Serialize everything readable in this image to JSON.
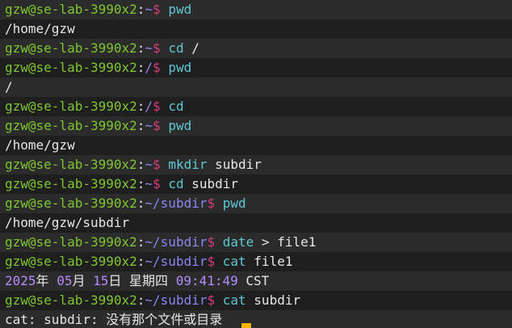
{
  "prompt": {
    "user_host": "gzw@se-lab-3990x2",
    "colon": ":",
    "symbol": "$"
  },
  "lines": [
    {
      "type": "prompt",
      "dir": "~",
      "cmd": "pwd",
      "args": ""
    },
    {
      "type": "output",
      "text": "/home/gzw"
    },
    {
      "type": "prompt",
      "dir": "~",
      "cmd": "cd",
      "args": "/"
    },
    {
      "type": "prompt",
      "dir": "/",
      "cmd": "pwd",
      "args": ""
    },
    {
      "type": "output",
      "text": "/"
    },
    {
      "type": "prompt",
      "dir": "/",
      "cmd": "cd",
      "args": ""
    },
    {
      "type": "prompt",
      "dir": "~",
      "cmd": "pwd",
      "args": ""
    },
    {
      "type": "output",
      "text": "/home/gzw"
    },
    {
      "type": "prompt",
      "dir": "~",
      "cmd": "mkdir",
      "args": "subdir"
    },
    {
      "type": "prompt",
      "dir": "~",
      "cmd": "cd",
      "args": "subdir"
    },
    {
      "type": "prompt",
      "dir": "~/subdir",
      "cmd": "pwd",
      "args": ""
    },
    {
      "type": "output",
      "text": "/home/gzw/subdir"
    },
    {
      "type": "prompt",
      "dir": "~/subdir",
      "cmd": "date",
      "args": "> file1"
    },
    {
      "type": "prompt",
      "dir": "~/subdir",
      "cmd": "cat",
      "args": "file1"
    },
    {
      "type": "date",
      "year": "2025",
      "yearSuffix": "年",
      "month": "05",
      "monthSuffix": "月",
      "day": "15",
      "daySuffix": "日",
      "weekday": "星期四",
      "time": "09:41:49",
      "tz": "CST"
    },
    {
      "type": "prompt",
      "dir": "~/subdir",
      "cmd": "cat",
      "args": "subdir"
    },
    {
      "type": "error",
      "prefix": "cat",
      "target": "subdir",
      "message": "没有那个文件或目录"
    }
  ],
  "colors": {
    "background": "#1e1e1e",
    "user_host": "#7fc62f",
    "directory": "#8c86f2",
    "symbol": "#d23c78",
    "command": "#5dc8d4",
    "cursor": "#f4b400"
  }
}
